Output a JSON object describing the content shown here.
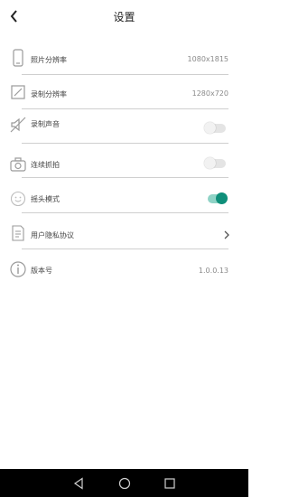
{
  "header": {
    "title": "设置",
    "back_icon": "chevron-left-icon"
  },
  "settings": [
    {
      "icon": "phone-icon",
      "label": "照片分辨率",
      "value": "1080x1815"
    },
    {
      "icon": "edit-square-icon",
      "label": "录制分辨率",
      "value": "1280x720"
    },
    {
      "icon": "mute-icon",
      "label": "录制声音",
      "toggle": false
    },
    {
      "icon": "camera-icon",
      "label": "连续抓拍",
      "toggle": false
    },
    {
      "icon": "smile-icon",
      "label": "摇头模式",
      "toggle": true
    },
    {
      "icon": "document-icon",
      "label": "用户隐私协议",
      "chevron": true
    },
    {
      "icon": "info-icon",
      "label": "版本号",
      "value": "1.0.0.13"
    }
  ],
  "navbar": {
    "buttons": [
      "back-triangle-icon",
      "home-circle-icon",
      "recents-square-icon"
    ]
  }
}
